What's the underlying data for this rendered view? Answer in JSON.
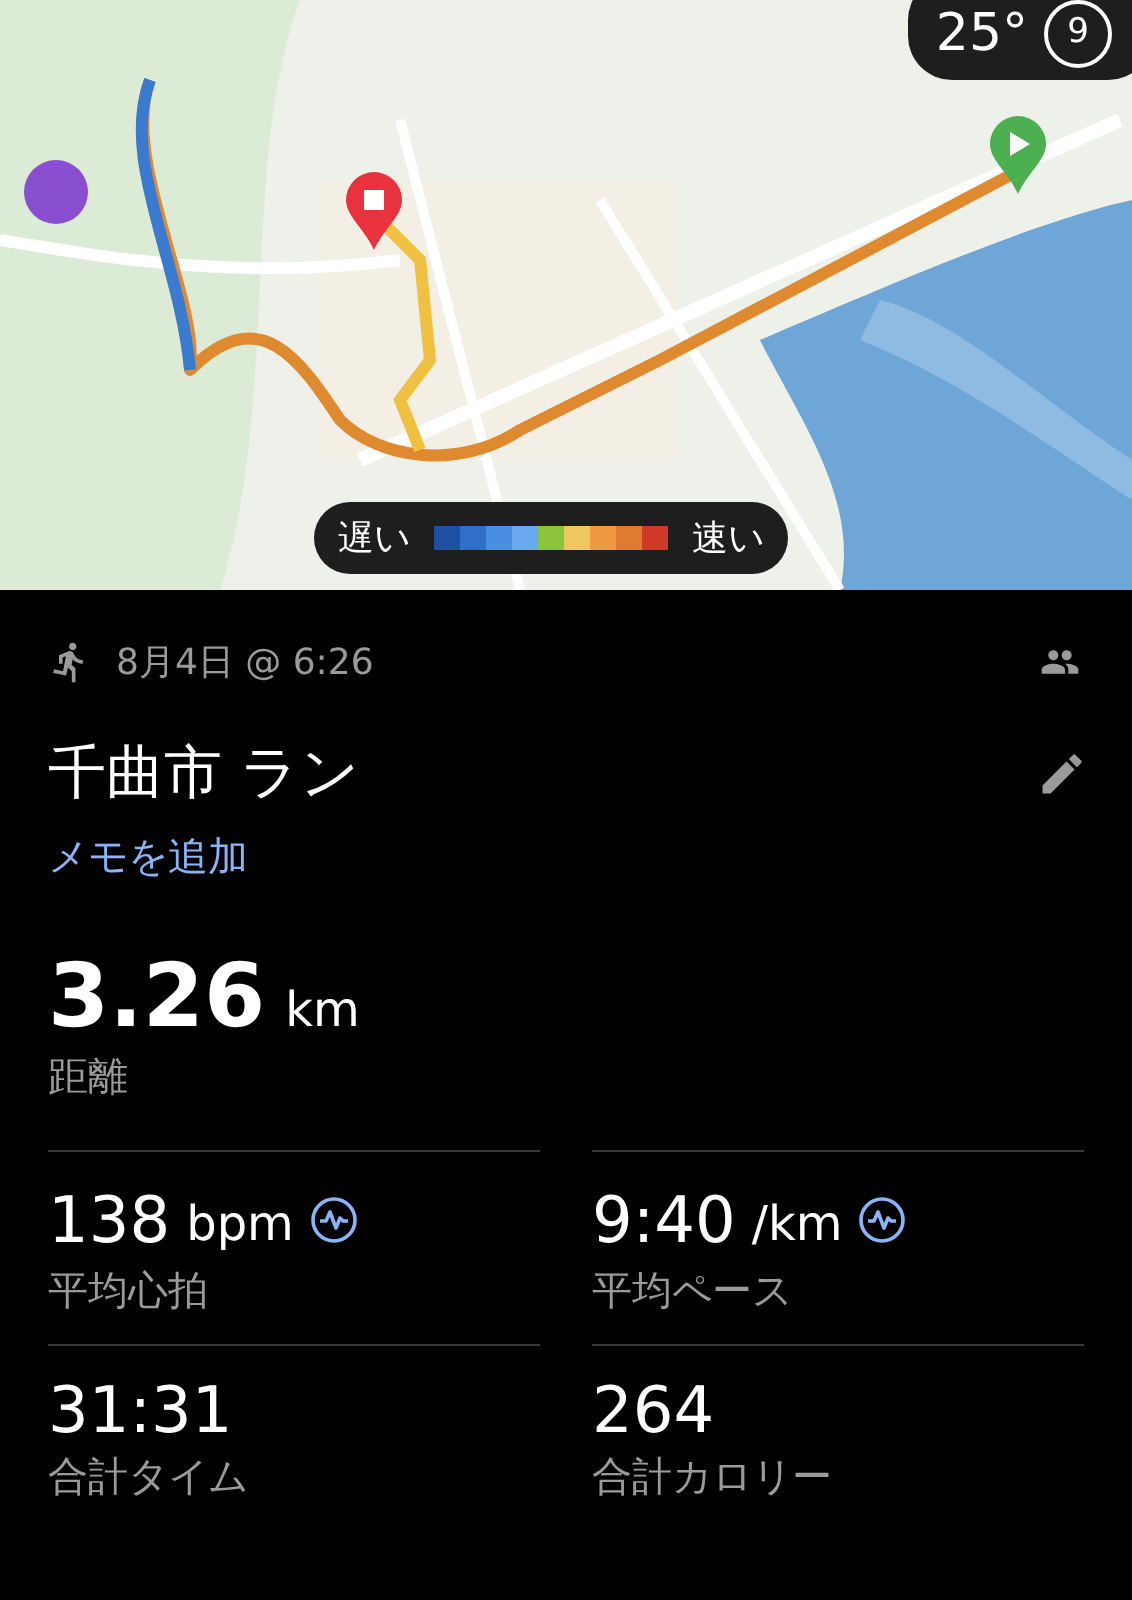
{
  "weather": {
    "temperature": "25°",
    "index": "9"
  },
  "legend": {
    "slow": "遅い",
    "fast": "速い",
    "swatches": [
      {
        "color": "#1f4fa0"
      },
      {
        "color": "#2f6fc8"
      },
      {
        "color": "#4a8ee0"
      },
      {
        "color": "#6aa8f0"
      },
      {
        "color": "#8cc43c"
      },
      {
        "color": "#f0c860"
      },
      {
        "color": "#ee9a40"
      },
      {
        "color": "#e07a30"
      },
      {
        "color": "#d03a2a"
      }
    ]
  },
  "activity": {
    "date": "8月4日 @ 6:26",
    "title": "千曲市 ラン",
    "add_note": "メモを追加",
    "distance": {
      "value": "3.26",
      "unit": "km",
      "label": "距離"
    }
  },
  "stats": [
    {
      "value": "138",
      "unit": "bpm",
      "label": "平均心拍",
      "chart_link": true
    },
    {
      "value": "9:40",
      "unit": "/km",
      "label": "平均ペース",
      "chart_link": true
    },
    {
      "value": "31:31",
      "label": "合計タイム",
      "chart_link": false
    },
    {
      "value": "264",
      "label": "合計カロリー",
      "chart_link": false
    }
  ]
}
